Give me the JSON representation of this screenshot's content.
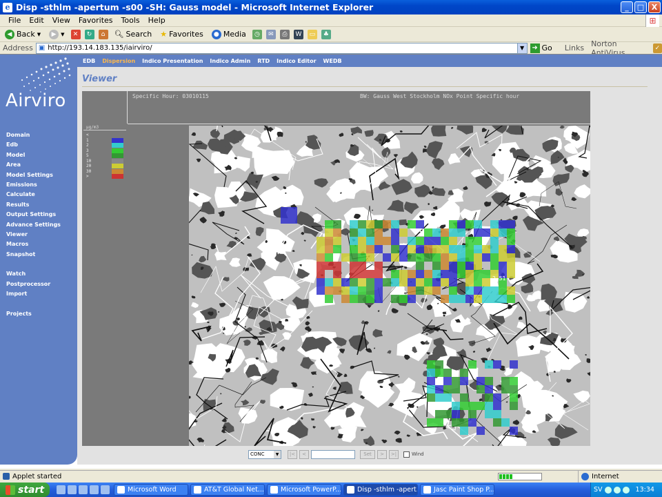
{
  "window": {
    "title": "Disp -sthlm -apertum -s00 -SH: Gauss model - Microsoft Internet Explorer",
    "buttons": {
      "minimize": "_",
      "maximize": "□",
      "close": "X"
    }
  },
  "menu": [
    "File",
    "Edit",
    "View",
    "Favorites",
    "Tools",
    "Help"
  ],
  "toolbar": {
    "back": "Back",
    "search": "Search",
    "favorites": "Favorites",
    "media": "Media"
  },
  "address": {
    "label": "Address",
    "url": "http://193.14.183.135/iairviro/",
    "go": "Go",
    "links": "Links",
    "antivirus": "Norton AntiVirus"
  },
  "app": {
    "logo": "Airviro",
    "topnav": [
      {
        "label": "EDB",
        "active": false
      },
      {
        "label": "Dispersion",
        "active": true
      },
      {
        "label": "Indico Presentation",
        "active": false
      },
      {
        "label": "Indico Admin",
        "active": false
      },
      {
        "label": "RTD",
        "active": false
      },
      {
        "label": "Indico Editor",
        "active": false
      },
      {
        "label": "WEDB",
        "active": false
      }
    ],
    "sidebar": [
      "Domain",
      "Edb",
      "Model",
      "Area",
      "Model Settings",
      "Emissions",
      "Calculate",
      "Results",
      "Output Settings",
      "Advance Settings",
      "Viewer",
      "Macros",
      "Snapshot",
      "",
      "Watch",
      "Postprocessor",
      "Import",
      "",
      "Projects"
    ],
    "page_title": "Viewer"
  },
  "viewer": {
    "info_left": "Specific Hour: 03010115",
    "info_right": "BW: Gauss West Stockholm NOx Point Specific hour",
    "legend_unit": "µg/m3",
    "legend": [
      {
        "label": "<",
        "color": ""
      },
      {
        "label": "1",
        "color": "#3333cc"
      },
      {
        "label": "2",
        "color": "#33cccc"
      },
      {
        "label": "3",
        "color": "#33cc33"
      },
      {
        "label": "5",
        "color": "#339933"
      },
      {
        "label": "10",
        "color": "#888888"
      },
      {
        "label": "20",
        "color": "#cccc33"
      },
      {
        "label": "30",
        "color": "#cc8833"
      },
      {
        "label": ">",
        "color": "#cc3333"
      }
    ],
    "map_label": "2.51",
    "controls": {
      "mode": "CONC",
      "prev2": "|<",
      "prev": "<",
      "set": "Set",
      "next": ">",
      "next2": ">|",
      "wind": "Wind"
    }
  },
  "status": {
    "text": "Applet started",
    "zone": "Internet"
  },
  "taskbar": {
    "start": "start",
    "tasks": [
      {
        "label": "Microsoft Word",
        "active": false
      },
      {
        "label": "AT&T Global Net...",
        "active": false
      },
      {
        "label": "Microsoft PowerP...",
        "active": false
      },
      {
        "label": "Disp -sthlm -apert...",
        "active": true
      },
      {
        "label": "Jasc Paint Shop P...",
        "active": false
      }
    ],
    "lang": "SV",
    "clock": "13:34"
  }
}
